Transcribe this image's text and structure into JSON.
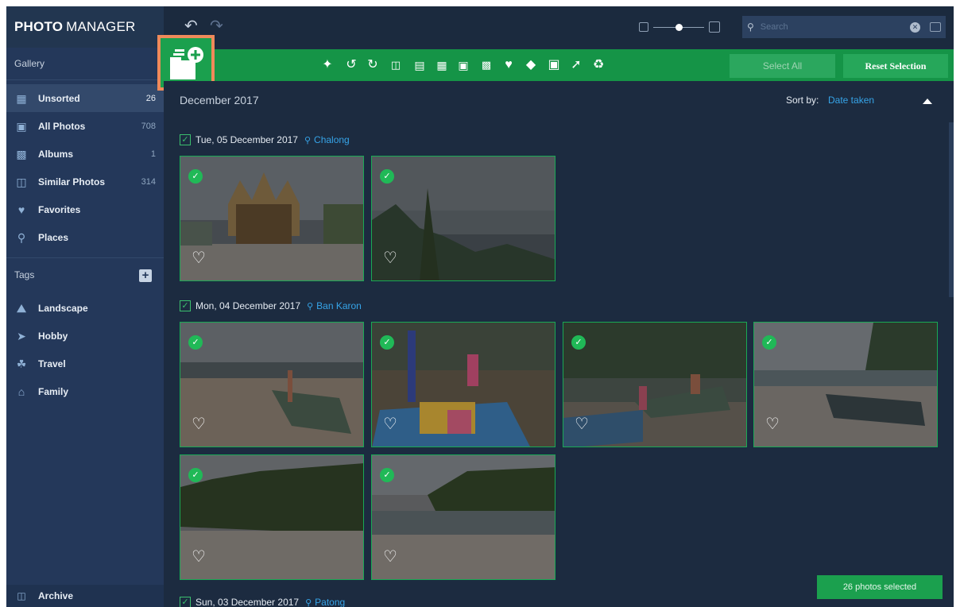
{
  "app": {
    "title_bold": "PHOTO",
    "title_light": "MANAGER"
  },
  "topbar": {
    "undo_icon": "undo-icon",
    "redo_icon": "redo-icon",
    "search_placeholder": "Search"
  },
  "actionbar": {
    "tools": [
      "magic-wand-icon",
      "rotate-left-icon",
      "rotate-right-icon",
      "flip-horizontal-icon",
      "flip-vertical-icon",
      "crop-icon",
      "resize-icon",
      "convert-icon",
      "heart-icon",
      "tag-icon",
      "add-to-album-icon",
      "share-icon",
      "delete-icon"
    ],
    "select_all": "Select All",
    "reset_selection": "Reset Selection"
  },
  "sidebar": {
    "gallery_label": "Gallery",
    "items": [
      {
        "label": "Unsorted",
        "count": "26",
        "icon": "unsorted-icon"
      },
      {
        "label": "All Photos",
        "count": "708",
        "icon": "all-photos-icon"
      },
      {
        "label": "Albums",
        "count": "1",
        "icon": "albums-icon"
      },
      {
        "label": "Similar Photos",
        "count": "314",
        "icon": "similar-photos-icon"
      },
      {
        "label": "Favorites",
        "count": "",
        "icon": "heart-icon"
      },
      {
        "label": "Places",
        "count": "",
        "icon": "places-icon"
      }
    ],
    "tags_label": "Tags",
    "tags": [
      {
        "label": "Landscape",
        "icon": "landscape-icon"
      },
      {
        "label": "Hobby",
        "icon": "hobby-icon"
      },
      {
        "label": "Travel",
        "icon": "travel-icon"
      },
      {
        "label": "Family",
        "icon": "family-icon"
      }
    ],
    "archive_label": "Archive"
  },
  "main": {
    "month": "December 2017",
    "sort_label": "Sort by:",
    "sort_value": "Date taken",
    "days": [
      {
        "date": "Tue, 05 December 2017",
        "place": "Chalong"
      },
      {
        "date": "Mon, 04 December 2017",
        "place": "Ban Karon"
      },
      {
        "date": "Sun, 03 December 2017",
        "place": "Patong"
      }
    ],
    "selected_count": "26 photos selected"
  },
  "colors": {
    "accent_green": "#159447",
    "link_blue": "#36a4e8",
    "highlight_orange": "#ef8a5a"
  }
}
